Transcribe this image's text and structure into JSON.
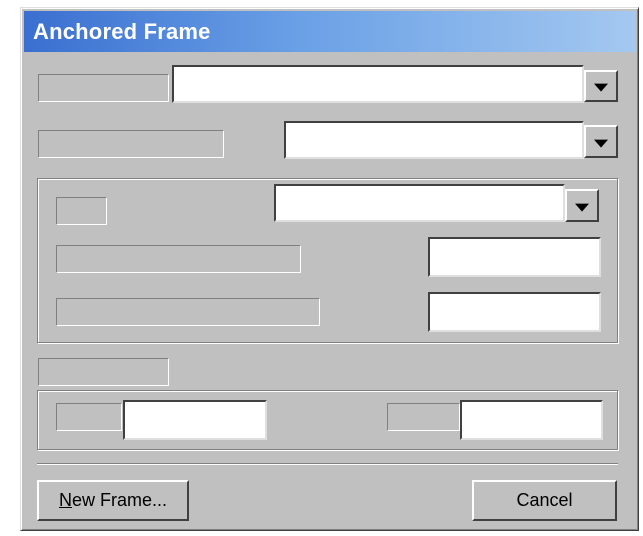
{
  "window": {
    "title": "Anchored Frame"
  },
  "colors": {
    "title_gradient_start": "#3a6fd0",
    "title_gradient_end": "#a4c8f0",
    "dialog_face": "#c0c0c0"
  },
  "fields": {
    "top_combo_value": "",
    "second_combo_value": "",
    "group_combo_value": "",
    "group_text1_value": "",
    "group_text2_value": "",
    "bottom_left_value": "",
    "bottom_right_value": ""
  },
  "icons": {
    "dropdown": "chevron-down-icon"
  },
  "buttons": {
    "new_frame_mnemonic": "N",
    "new_frame_rest": "ew Frame...",
    "cancel": "Cancel"
  }
}
